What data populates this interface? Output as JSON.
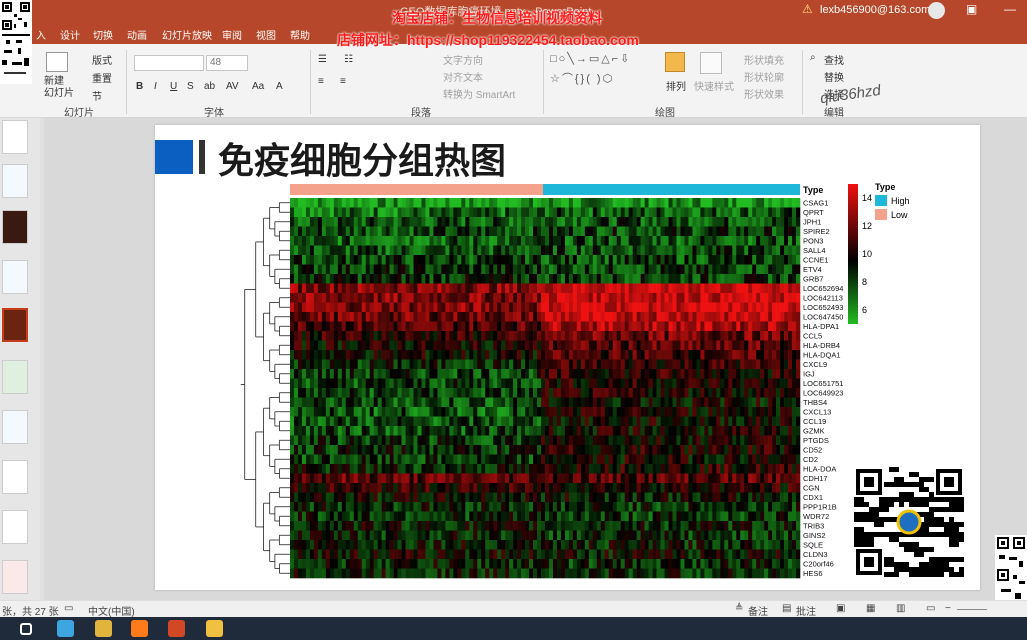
{
  "window": {
    "doc_title": "GEO数据库胞癌环境.pptx - PowerPoint",
    "user": "lexb456900@163.com",
    "warn_icon": "warning-icon"
  },
  "watermarks": {
    "line1": "淘宝店铺：生物信息培训视频资料",
    "line2": "店铺网址：https://shop119322454.taobao.com",
    "handwriting": "qiu36hzd"
  },
  "tabs": [
    "入",
    "设计",
    "切换",
    "动画",
    "幻灯片放映",
    "审阅",
    "视图",
    "帮助"
  ],
  "ribbon": {
    "slides_group": {
      "label": "幻灯片",
      "new_slide": "新建\n幻灯片",
      "layout": "版式",
      "reset": "重置",
      "section": "节"
    },
    "font_group": {
      "label": "字体",
      "font_name": "",
      "font_size": "48"
    },
    "paragraph_group": {
      "label": "段落",
      "text_direction": "文字方向",
      "align_text": "对齐文本",
      "smartart": "转换为 SmartArt"
    },
    "drawing_group": {
      "label": "绘图",
      "arrange": "排列",
      "quick_styles": "快速样式",
      "shape_fill": "形状填充",
      "shape_outline": "形状轮廓",
      "shape_effects": "形状效果"
    },
    "editing_group": {
      "label": "编辑",
      "find": "查找",
      "replace": "替换",
      "select": "选择"
    }
  },
  "slide": {
    "title": "免疫细胞分组热图"
  },
  "chart_data": {
    "type": "heatmap",
    "annotation_title": "Type",
    "groups": [
      {
        "name": "Low",
        "color": "#f4a28c"
      },
      {
        "name": "High",
        "color": "#1fb7d9"
      }
    ],
    "color_scale": {
      "ticks": [
        14,
        12,
        10,
        8,
        6
      ],
      "low_color": "#22bb22",
      "mid_color": "#000000",
      "high_color": "#ee1111"
    },
    "rows": [
      {
        "gene": "CSAG1",
        "low": 6.5,
        "high": 6.8
      },
      {
        "gene": "QPRT",
        "low": 7.5,
        "high": 8.0
      },
      {
        "gene": "JPH1",
        "low": 8.0,
        "high": 8.2
      },
      {
        "gene": "SPIRE2",
        "low": 8.3,
        "high": 8.5
      },
      {
        "gene": "PON3",
        "low": 7.8,
        "high": 8.1
      },
      {
        "gene": "SALL4",
        "low": 8.0,
        "high": 8.3
      },
      {
        "gene": "CCNE1",
        "low": 8.4,
        "high": 8.3
      },
      {
        "gene": "ETV4",
        "low": 8.6,
        "high": 8.4
      },
      {
        "gene": "GRB7",
        "low": 8.8,
        "high": 8.5
      },
      {
        "gene": "LOC652694",
        "low": 12.0,
        "high": 13.5
      },
      {
        "gene": "LOC642113",
        "low": 11.8,
        "high": 13.4
      },
      {
        "gene": "LOC652493",
        "low": 11.9,
        "high": 13.6
      },
      {
        "gene": "LOC647450",
        "low": 11.5,
        "high": 13.2
      },
      {
        "gene": "HLA-DPA1",
        "low": 11.0,
        "high": 12.8
      },
      {
        "gene": "CCL5",
        "low": 10.2,
        "high": 11.5
      },
      {
        "gene": "HLA-DRB4",
        "low": 9.8,
        "high": 11.0
      },
      {
        "gene": "HLA-DQA1",
        "low": 9.6,
        "high": 10.8
      },
      {
        "gene": "CXCL9",
        "low": 8.8,
        "high": 10.4
      },
      {
        "gene": "IGJ",
        "low": 8.5,
        "high": 10.2
      },
      {
        "gene": "LOC651751",
        "low": 8.4,
        "high": 10.0
      },
      {
        "gene": "LOC649923",
        "low": 8.3,
        "high": 9.9
      },
      {
        "gene": "THBS4",
        "low": 8.2,
        "high": 9.5
      },
      {
        "gene": "CXCL13",
        "low": 8.0,
        "high": 9.8
      },
      {
        "gene": "CCL19",
        "low": 8.1,
        "high": 9.6
      },
      {
        "gene": "GZMK",
        "low": 8.2,
        "high": 9.6
      },
      {
        "gene": "PTGDS",
        "low": 8.6,
        "high": 9.8
      },
      {
        "gene": "CD52",
        "low": 8.8,
        "high": 10.0
      },
      {
        "gene": "CD2",
        "low": 8.4,
        "high": 9.7
      },
      {
        "gene": "HLA-DOA",
        "low": 9.0,
        "high": 10.2
      },
      {
        "gene": "CDH17",
        "low": 11.2,
        "high": 11.0
      },
      {
        "gene": "CGN",
        "low": 10.2,
        "high": 10.0
      },
      {
        "gene": "CDX1",
        "low": 9.5,
        "high": 9.3
      },
      {
        "gene": "PPP1R1B",
        "low": 9.0,
        "high": 8.8
      },
      {
        "gene": "WDR72",
        "low": 8.8,
        "high": 8.6
      },
      {
        "gene": "TRIB3",
        "low": 9.2,
        "high": 9.0
      },
      {
        "gene": "GINS2",
        "low": 9.0,
        "high": 8.7
      },
      {
        "gene": "SQLE",
        "low": 9.3,
        "high": 9.0
      },
      {
        "gene": "CLDN3",
        "low": 9.6,
        "high": 9.4
      },
      {
        "gene": "C20orf46",
        "low": 9.0,
        "high": 8.8
      },
      {
        "gene": "HES6",
        "low": 9.1,
        "high": 8.9
      }
    ]
  },
  "status": {
    "slide_info": "张，共 27 张",
    "language": "中文(中国)",
    "notes": "备注",
    "comments": "批注"
  },
  "taskbar": {
    "icons": [
      {
        "name": "start-icon",
        "color": "#ffffff"
      },
      {
        "name": "browser-icon",
        "color": "#3da5e0"
      },
      {
        "name": "tool-icon",
        "color": "#e0b43d"
      },
      {
        "name": "firefox-icon",
        "color": "#ff7a1a"
      },
      {
        "name": "powerpoint-icon",
        "color": "#d24726"
      },
      {
        "name": "folder-icon",
        "color": "#f0c040"
      }
    ]
  }
}
